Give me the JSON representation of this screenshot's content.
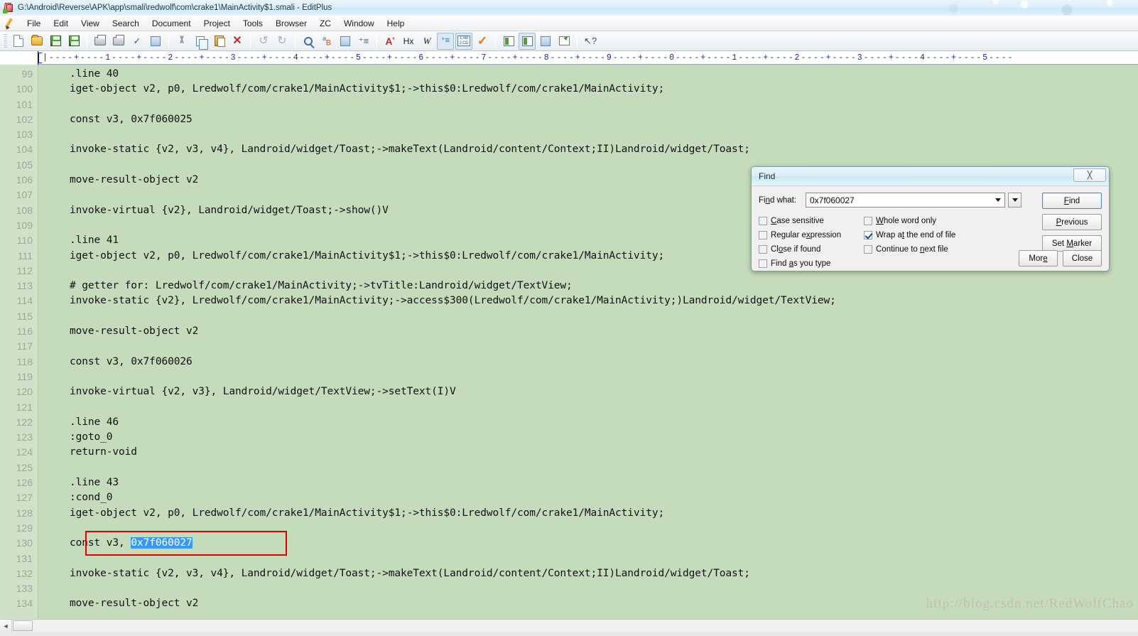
{
  "window": {
    "title": "G:\\Android\\Reverse\\APK\\app\\smali\\redwolf\\com\\crake1\\MainActivity$1.smali - EditPlus",
    "app_icon": "editplus-icon"
  },
  "menubar": {
    "items": [
      {
        "label": "File"
      },
      {
        "label": "Edit"
      },
      {
        "label": "View"
      },
      {
        "label": "Search"
      },
      {
        "label": "Document"
      },
      {
        "label": "Project"
      },
      {
        "label": "Tools"
      },
      {
        "label": "Browser"
      },
      {
        "label": "ZC"
      },
      {
        "label": "Window"
      },
      {
        "label": "Help"
      }
    ]
  },
  "toolbar": {
    "icons": [
      "new-document-icon",
      "open-folder-icon",
      "save-icon",
      "save-all-icon",
      "print-preview-icon",
      "print-icon",
      "spell-check-icon",
      "view-source-icon",
      "cut-icon",
      "copy-icon",
      "paste-icon",
      "delete-icon",
      "undo-icon",
      "redo-icon",
      "find-icon",
      "replace-icon",
      "goto-icon",
      "insert-numbers-icon",
      "font-icon",
      "hex-icon",
      "word-wrap-icon",
      "indent-icon",
      "sort-icon",
      "check-icon",
      "clip-library-icon",
      "directory-window-icon",
      "preview-icon",
      "browser-icon",
      "context-help-icon"
    ]
  },
  "ruler": {
    "marks": "|----+----1----+----2----+----3----+----4----+----5----+----6----+----7----+----8----+----9----+----0----+----1----+----2----+----3----+----4----+----5----"
  },
  "editor": {
    "first_line_number": 99,
    "background_color": "#c4dbbc",
    "gutter_color": "#cfe2c8",
    "line_number_color": "#9aa79a",
    "selection_color": "#3399ff",
    "annotation_box_color": "#e00000",
    "watermark": "http://blog.csdn.net/RedWolfChao",
    "lines": [
      {
        "n": 99,
        "text": ".line 40"
      },
      {
        "n": 100,
        "text": "iget-object v2, p0, Lredwolf/com/crake1/MainActivity$1;->this$0:Lredwolf/com/crake1/MainActivity;"
      },
      {
        "n": 101,
        "text": ""
      },
      {
        "n": 102,
        "text": "const v3, 0x7f060025"
      },
      {
        "n": 103,
        "text": ""
      },
      {
        "n": 104,
        "text": "invoke-static {v2, v3, v4}, Landroid/widget/Toast;->makeText(Landroid/content/Context;II)Landroid/widget/Toast;"
      },
      {
        "n": 105,
        "text": ""
      },
      {
        "n": 106,
        "text": "move-result-object v2"
      },
      {
        "n": 107,
        "text": ""
      },
      {
        "n": 108,
        "text": "invoke-virtual {v2}, Landroid/widget/Toast;->show()V"
      },
      {
        "n": 109,
        "text": ""
      },
      {
        "n": 110,
        "text": ".line 41"
      },
      {
        "n": 111,
        "text": "iget-object v2, p0, Lredwolf/com/crake1/MainActivity$1;->this$0:Lredwolf/com/crake1/MainActivity;"
      },
      {
        "n": 112,
        "text": ""
      },
      {
        "n": 113,
        "text": "# getter for: Lredwolf/com/crake1/MainActivity;->tvTitle:Landroid/widget/TextView;"
      },
      {
        "n": 114,
        "text": "invoke-static {v2}, Lredwolf/com/crake1/MainActivity;->access$300(Lredwolf/com/crake1/MainActivity;)Landroid/widget/TextView;"
      },
      {
        "n": 115,
        "text": ""
      },
      {
        "n": 116,
        "text": "move-result-object v2"
      },
      {
        "n": 117,
        "text": ""
      },
      {
        "n": 118,
        "text": "const v3, 0x7f060026"
      },
      {
        "n": 119,
        "text": ""
      },
      {
        "n": 120,
        "text": "invoke-virtual {v2, v3}, Landroid/widget/TextView;->setText(I)V"
      },
      {
        "n": 121,
        "text": ""
      },
      {
        "n": 122,
        "text": ".line 46"
      },
      {
        "n": 123,
        "text": ":goto_0"
      },
      {
        "n": 124,
        "text": "return-void"
      },
      {
        "n": 125,
        "text": ""
      },
      {
        "n": 126,
        "text": ".line 43"
      },
      {
        "n": 127,
        "text": ":cond_0"
      },
      {
        "n": 128,
        "text": "iget-object v2, p0, Lredwolf/com/crake1/MainActivity$1;->this$0:Lredwolf/com/crake1/MainActivity;"
      },
      {
        "n": 129,
        "text": ""
      },
      {
        "n": 130,
        "text": "const v3, ",
        "selected": "0x7f060027"
      },
      {
        "n": 131,
        "text": ""
      },
      {
        "n": 132,
        "text": "invoke-static {v2, v3, v4}, Landroid/widget/Toast;->makeText(Landroid/content/Context;II)Landroid/widget/Toast;"
      },
      {
        "n": 133,
        "text": ""
      },
      {
        "n": 134,
        "text": "move-result-object v2"
      }
    ]
  },
  "find_dialog": {
    "title": "Find",
    "close_label": "╳",
    "find_what_label": "Find what:",
    "find_what_value": "0x7f060027",
    "checkboxes": [
      {
        "label": "Case sensitive",
        "checked": false,
        "accel": "C"
      },
      {
        "label": "Regular expression",
        "checked": false,
        "accel": "x"
      },
      {
        "label": "Close if found",
        "checked": false,
        "accel": "o"
      },
      {
        "label": "Find as you type",
        "checked": false,
        "accel": "a"
      },
      {
        "label": "Whole word only",
        "checked": false,
        "accel": "W"
      },
      {
        "label": "Wrap at the end of file",
        "checked": true,
        "accel": "t"
      },
      {
        "label": "Continue to next file",
        "checked": false,
        "accel": "n"
      }
    ],
    "buttons": {
      "find": "Find",
      "previous": "Previous",
      "set_marker": "Set Marker",
      "more": "More",
      "close": "Close"
    }
  },
  "scrollbar": {
    "left_arrow": "◄",
    "thumb": "h-scroll-thumb"
  }
}
